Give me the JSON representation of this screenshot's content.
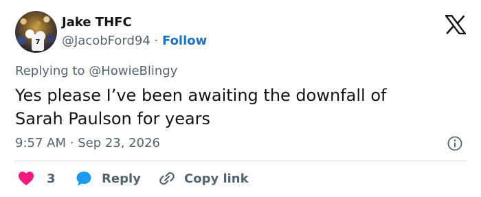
{
  "author": {
    "display_name": "Jake THFC",
    "handle": "@JacobFord94",
    "separator": "·",
    "follow_label": "Follow",
    "avatar_shirt_number": "7"
  },
  "reply_context": {
    "prefix": "Replying to ",
    "mention": "@HowieBlingy"
  },
  "tweet": {
    "text_line1": "Yes please I’ve been awaiting the downfall of",
    "text_line2": "Sarah Paulson for years",
    "time": "9:57 AM",
    "separator": "·",
    "date": "Sep 23, 2026"
  },
  "actions": {
    "like_count": "3",
    "reply_label": "Reply",
    "copy_link_label": "Copy link"
  },
  "icons": {
    "brand": "x-logo-icon",
    "info": "info-icon",
    "like": "heart-icon",
    "reply": "speech-bubble-icon",
    "copy": "link-icon"
  },
  "colors": {
    "like": "#f91880",
    "reply": "#1d9bf0",
    "follow_link": "#1d73c9",
    "muted_text": "#536471",
    "divider": "#cfd9de"
  }
}
